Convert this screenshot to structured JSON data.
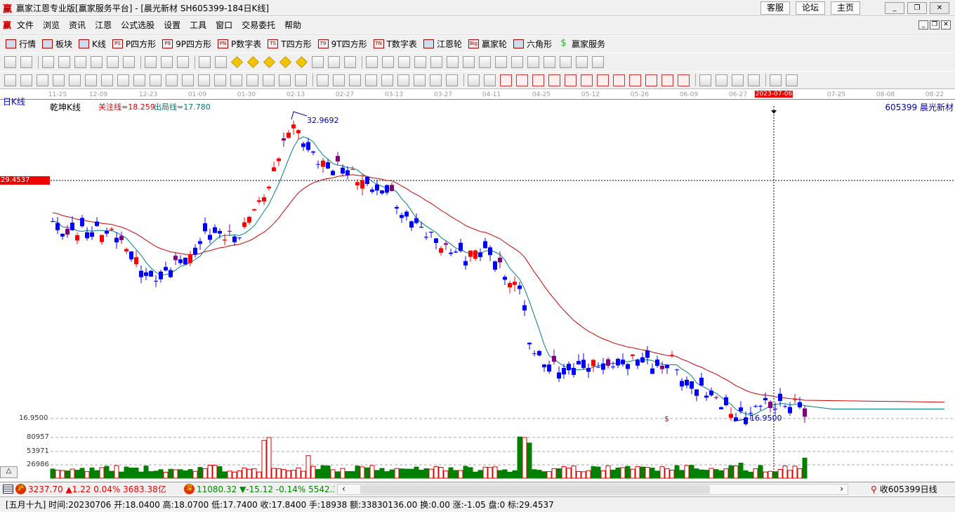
{
  "window": {
    "logo": "赢",
    "title": "赢家江恩专业版[赢家服务平台] - [晨光新材  SH605399-184日K线]",
    "buttons": [
      "客服",
      "论坛",
      "主页"
    ]
  },
  "menu": {
    "logo": "赢",
    "items": [
      "文件",
      "浏览",
      "资讯",
      "江恩",
      "公式选股",
      "设置",
      "工具",
      "窗口",
      "交易委托",
      "帮助"
    ]
  },
  "toolbar1": [
    {
      "icon": "grid",
      "label": "行情"
    },
    {
      "icon": "blocks",
      "label": "板块"
    },
    {
      "icon": "candles",
      "label": "K线"
    },
    {
      "icon": "PS",
      "label": "P四方形"
    },
    {
      "icon": "P9",
      "label": "9P四方形"
    },
    {
      "icon": "PN",
      "label": "P数字表"
    },
    {
      "icon": "TS",
      "label": "T四方形"
    },
    {
      "icon": "T9",
      "label": "9T四方形"
    },
    {
      "icon": "TN",
      "label": "T数字表"
    },
    {
      "icon": "target",
      "label": "江恩轮"
    },
    {
      "icon": "Big",
      "label": "赢家轮"
    },
    {
      "icon": "hexagon",
      "label": "六角形"
    },
    {
      "icon": "$",
      "label": "赢家服务"
    }
  ],
  "chart": {
    "period_label": "日K线",
    "indicator": "乾坤K线",
    "focus_line": "关注线=18.259",
    "exit_line": "出局线=17.780",
    "stock": "605399  晨光新材",
    "crosshair_price": "29.4537",
    "low_label": "16.9500",
    "high_mark": "32.9692",
    "low_mark": "16.9500",
    "dollar": "$",
    "dates": [
      "11-25",
      "12-09",
      "12-23",
      "01-09",
      "01-30",
      "02-13",
      "02-27",
      "03-13",
      "03-27",
      "04-11",
      "04-25",
      "05-12",
      "05-26",
      "06-09",
      "06-27",
      "2023-07-06",
      "07-25",
      "08-08",
      "08-22"
    ],
    "vol_ticks": [
      "80957",
      "53971",
      "26986"
    ],
    "colors": {
      "up": "#ff0000",
      "down": "#0000ff",
      "mixed": "#800080",
      "ma_short": "#008080",
      "ma_long": "#cc0000",
      "vol_up": "#dd0000",
      "vol_down": "#008000"
    }
  },
  "chart_data": {
    "type": "candlestick",
    "title": "晨光新材 SH605399 日K线",
    "ylim": [
      16.95,
      32.9692
    ],
    "close_keypoints": [
      [
        0,
        27.31
      ],
      [
        2,
        26.76
      ],
      [
        8,
        26.84
      ],
      [
        12,
        26.76
      ],
      [
        15,
        25.84
      ],
      [
        20,
        24.18
      ],
      [
        24,
        24.99
      ],
      [
        28,
        25.29
      ],
      [
        31,
        26.58
      ],
      [
        38,
        26.58
      ],
      [
        41,
        27.87
      ],
      [
        44,
        28.97
      ],
      [
        46,
        30.82
      ],
      [
        49,
        32.29
      ],
      [
        52,
        31.0
      ],
      [
        56,
        30.08
      ],
      [
        59,
        30.27
      ],
      [
        64,
        29.16
      ],
      [
        67,
        28.97
      ],
      [
        69,
        28.97
      ],
      [
        71,
        27.5
      ],
      [
        75,
        26.95
      ],
      [
        79,
        26.02
      ],
      [
        84,
        25.47
      ],
      [
        88,
        26.02
      ],
      [
        91,
        24.92
      ],
      [
        93,
        24.0
      ],
      [
        95,
        24.0
      ],
      [
        97,
        20.86
      ],
      [
        100,
        19.94
      ],
      [
        105,
        19.39
      ],
      [
        109,
        19.75
      ],
      [
        115,
        19.94
      ],
      [
        119,
        20.12
      ],
      [
        124,
        19.57
      ],
      [
        126,
        20.12
      ],
      [
        128,
        18.83
      ],
      [
        132,
        18.46
      ],
      [
        135,
        17.91
      ],
      [
        139,
        16.99
      ],
      [
        143,
        17.36
      ],
      [
        144,
        17.84
      ],
      [
        148,
        17.65
      ],
      [
        152,
        17.73
      ],
      [
        153,
        17.47
      ]
    ],
    "volume_spikes": [
      [
        43,
        75000
      ],
      [
        44,
        80957
      ],
      [
        52,
        45000
      ],
      [
        95,
        82000
      ],
      [
        96,
        80957
      ],
      [
        97,
        70000
      ],
      [
        140,
        30000
      ],
      [
        153,
        40000
      ]
    ],
    "selected_bar": {
      "date": "20230706",
      "open": "18.0400",
      "high": "18.0700",
      "low": "17.7400",
      "close": "17.8400"
    }
  },
  "statusrow": {
    "sh_icon": "沪",
    "sh": "3237.70 ▲1.22 0.04% 3683.38亿",
    "sz_icon": "深",
    "sz": "11080.32 ▼-15.12 -0.14% 5542.38",
    "right": "收605399日线"
  },
  "bottom": "[五月十九] 时间:20230706 开:18.0400 高:18.0700 低:17.7400 收:17.8400 手:18938 额:33830136.00 换:0.00 涨:-1.05 盘:0 标:29.4537"
}
